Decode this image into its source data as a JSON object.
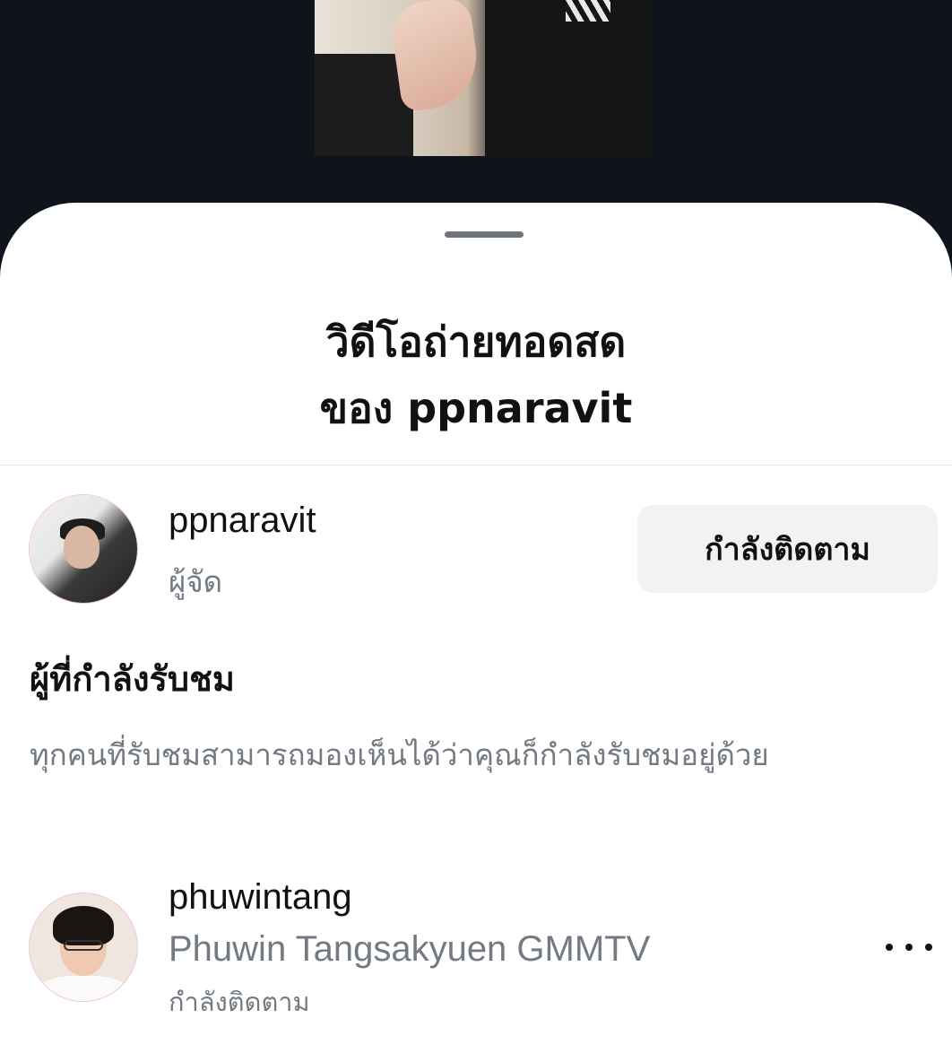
{
  "sheet": {
    "title_line1": "วิดีโอถ่ายทอดสด",
    "title_line2": "ของ ppnaravit"
  },
  "host": {
    "username": "ppnaravit",
    "role": "ผู้จัด",
    "follow_label": "กำลังติดตาม"
  },
  "viewers": {
    "heading": "ผู้ที่กำลังรับชม",
    "description": "ทุกคนที่รับชมสามารถมองเห็นได้ว่าคุณก็กำลังรับชมอยู่ด้วย",
    "items": [
      {
        "username": "phuwintang",
        "full_name": "Phuwin Tangsakyuen GMMTV",
        "status": "กำลังติดตาม",
        "more_icon": "more-horizontal-icon"
      }
    ]
  }
}
